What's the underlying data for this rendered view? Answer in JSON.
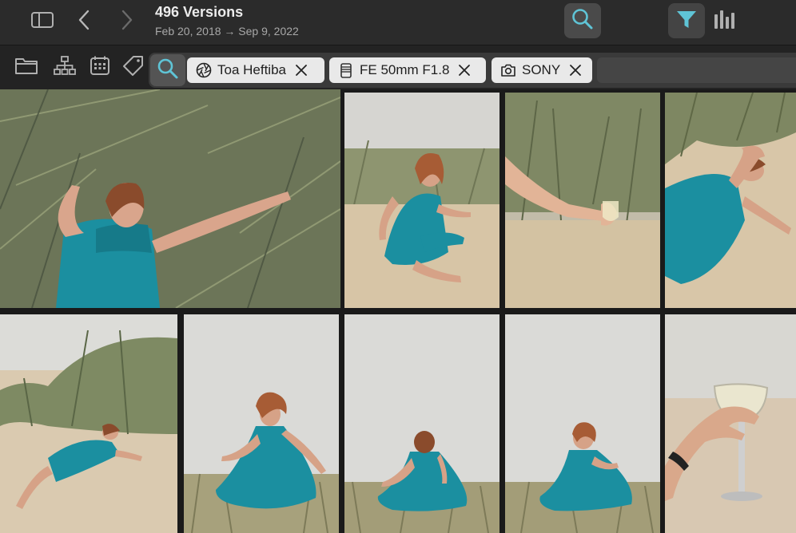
{
  "header": {
    "title": "496 Versions",
    "subtitle": "Feb 20, 2018 → Sep 9, 2022"
  },
  "toolbar": {
    "icons": [
      "sidebar-icon",
      "chevron-left-icon",
      "chevron-right-icon",
      "search-icon",
      "filter-icon",
      "histogram-icon",
      "folder-icon",
      "hierarchy-icon",
      "calendar-icon",
      "tag-icon"
    ]
  },
  "search": {
    "chips": [
      {
        "label": "Toa Heftiba",
        "icon": "aperture-icon"
      },
      {
        "label": "FE 50mm F1.8",
        "icon": "lens-icon"
      },
      {
        "label": "SONY",
        "icon": "camera-icon"
      }
    ],
    "placeholder": ""
  },
  "colors": {
    "accent": "#5fc4d6",
    "chip_bg": "#e9e9e9",
    "dress": "#1b8fa0"
  },
  "photos": [
    "woman-in-teal-dress-lying-in-grass",
    "woman-sitting-on-sand-dune",
    "hand-holding-wine-glass-in-grass",
    "woman-lying-on-sand-arms-out",
    "woman-lying-in-dunes-distance",
    "woman-dancing-twirling-dress",
    "woman-twirling-back-view",
    "woman-twirling-side-view",
    "hand-holding-wine-glass-closeup"
  ]
}
